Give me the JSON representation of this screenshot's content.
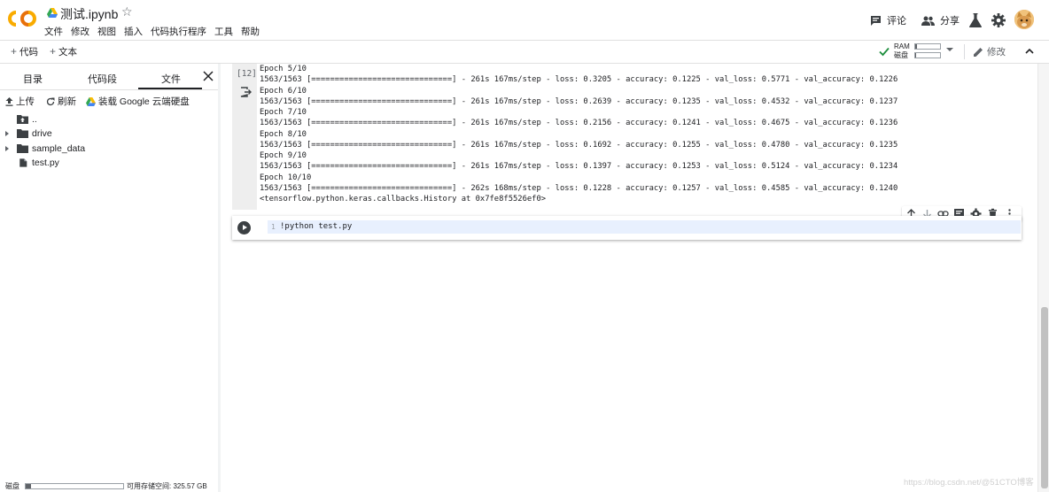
{
  "header": {
    "title": "测试.ipynb",
    "menu": [
      "文件",
      "修改",
      "视图",
      "插入",
      "代码执行程序",
      "工具",
      "帮助"
    ],
    "comment_label": "评论",
    "share_label": "分享"
  },
  "toolbar": {
    "add_code_label": "代码",
    "add_text_label": "文本",
    "ram_label": "RAM",
    "disk_label": "磁盘",
    "ram_fraction": 0.08,
    "disk_fraction": 0.03,
    "edit_label": "修改"
  },
  "sidebar": {
    "tabs": [
      "目录",
      "代码段",
      "文件"
    ],
    "active_tab": "文件",
    "actions": {
      "upload": "上传",
      "refresh": "刷新",
      "mount_drive": "装载 Google 云端硬盘"
    },
    "files": [
      {
        "name": "..",
        "type": "parent"
      },
      {
        "name": "drive",
        "type": "folder"
      },
      {
        "name": "sample_data",
        "type": "folder"
      },
      {
        "name": "test.py",
        "type": "file"
      }
    ],
    "footer": {
      "disk_label": "磁盘",
      "usage_fraction": 0.05,
      "available_text": "可用存储空间: 325.57 GB"
    }
  },
  "notebook": {
    "output_cell": {
      "exec_count": "[12]",
      "lines": [
        "Epoch 5/10",
        "1563/1563 [==============================] - 261s 167ms/step - loss: 0.3205 - accuracy: 0.1225 - val_loss: 0.5771 - val_accuracy: 0.1226",
        "Epoch 6/10",
        "1563/1563 [==============================] - 261s 167ms/step - loss: 0.2639 - accuracy: 0.1235 - val_loss: 0.4532 - val_accuracy: 0.1237",
        "Epoch 7/10",
        "1563/1563 [==============================] - 261s 167ms/step - loss: 0.2156 - accuracy: 0.1241 - val_loss: 0.4675 - val_accuracy: 0.1236",
        "Epoch 8/10",
        "1563/1563 [==============================] - 261s 167ms/step - loss: 0.1692 - accuracy: 0.1255 - val_loss: 0.4780 - val_accuracy: 0.1235",
        "Epoch 9/10",
        "1563/1563 [==============================] - 261s 167ms/step - loss: 0.1397 - accuracy: 0.1253 - val_loss: 0.5124 - val_accuracy: 0.1234",
        "Epoch 10/10",
        "1563/1563 [==============================] - 262s 168ms/step - loss: 0.1228 - accuracy: 0.1257 - val_loss: 0.4585 - val_accuracy: 0.1240",
        "<tensorflow.python.keras.callbacks.History at 0x7fe8f5526ef0>"
      ]
    },
    "code_cell": {
      "line_number": "1",
      "code": "!python test.py"
    }
  },
  "watermark": "https://blog.csdn.net/@51CTO博客",
  "colors": {
    "colab_orange": "#f9ab00",
    "check_green": "#1e8e3e",
    "drive_blue": "#4285f4"
  }
}
